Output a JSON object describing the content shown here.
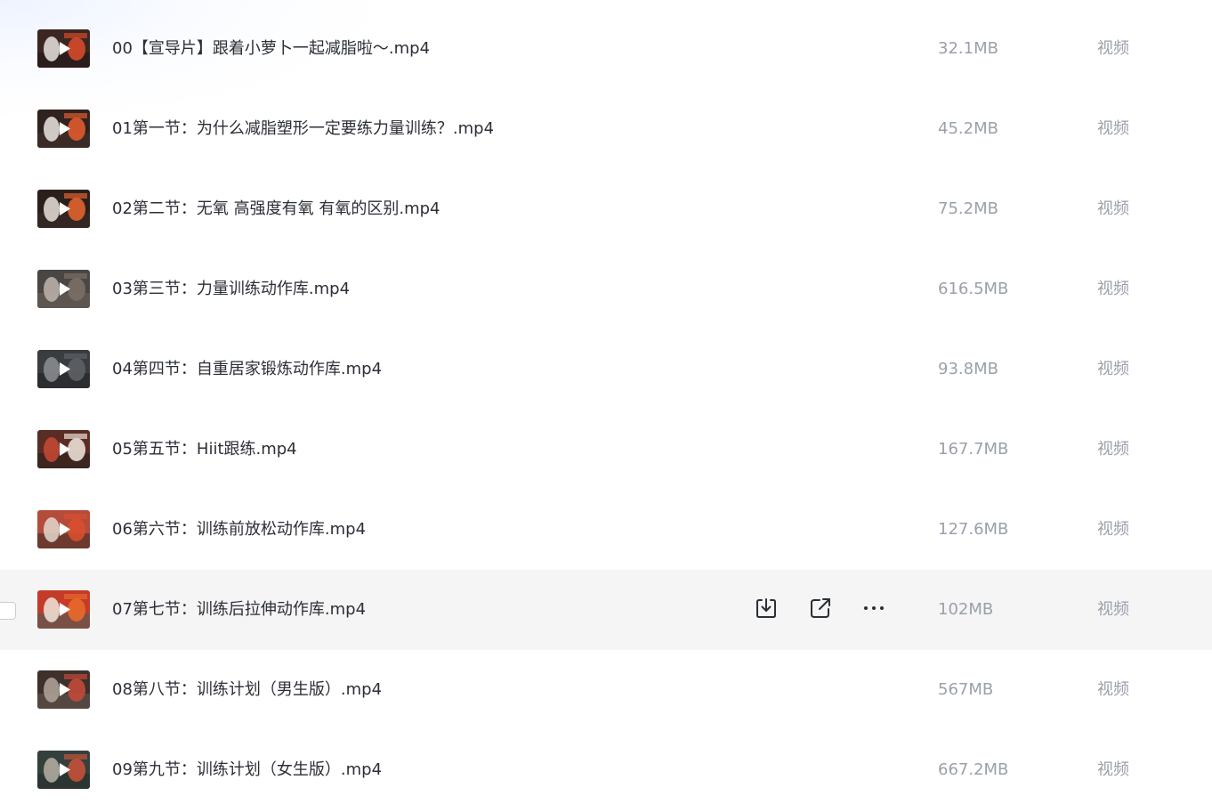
{
  "colors": {
    "hover_row_background": "#f5f5f6",
    "file_name_text": "#2b2f36",
    "meta_text": "#9aa0ab"
  },
  "row_actions": {
    "download_icon": "download-icon",
    "share_icon": "share-icon",
    "more_icon": "more-icon"
  },
  "files": [
    {
      "name": "00【宣导片】跟着小萝卜一起减脂啦～.mp4",
      "size": "32.1MB",
      "type": "视频",
      "thumbnail_icon": "video-thumbnail",
      "hovered": false
    },
    {
      "name": "01第一节：为什么减脂塑形一定要练力量训练？.mp4",
      "size": "45.2MB",
      "type": "视频",
      "thumbnail_icon": "video-thumbnail",
      "hovered": false
    },
    {
      "name": "02第二节：无氧 高强度有氧 有氧的区别.mp4",
      "size": "75.2MB",
      "type": "视频",
      "thumbnail_icon": "video-thumbnail",
      "hovered": false
    },
    {
      "name": "03第三节：力量训练动作库.mp4",
      "size": "616.5MB",
      "type": "视频",
      "thumbnail_icon": "video-thumbnail",
      "hovered": false
    },
    {
      "name": "04第四节：自重居家锻炼动作库.mp4",
      "size": "93.8MB",
      "type": "视频",
      "thumbnail_icon": "video-thumbnail",
      "hovered": false
    },
    {
      "name": "05第五节：Hiit跟练.mp4",
      "size": "167.7MB",
      "type": "视频",
      "thumbnail_icon": "video-thumbnail",
      "hovered": false
    },
    {
      "name": "06第六节：训练前放松动作库.mp4",
      "size": "127.6MB",
      "type": "视频",
      "thumbnail_icon": "video-thumbnail",
      "hovered": false
    },
    {
      "name": "07第七节：训练后拉伸动作库.mp4",
      "size": "102MB",
      "type": "视频",
      "thumbnail_icon": "video-thumbnail",
      "hovered": true
    },
    {
      "name": "08第八节：训练计划（男生版）.mp4",
      "size": "567MB",
      "type": "视频",
      "thumbnail_icon": "video-thumbnail",
      "hovered": false
    },
    {
      "name": "09第九节：训练计划（女生版）.mp4",
      "size": "667.2MB",
      "type": "视频",
      "thumbnail_icon": "video-thumbnail",
      "hovered": false
    }
  ]
}
